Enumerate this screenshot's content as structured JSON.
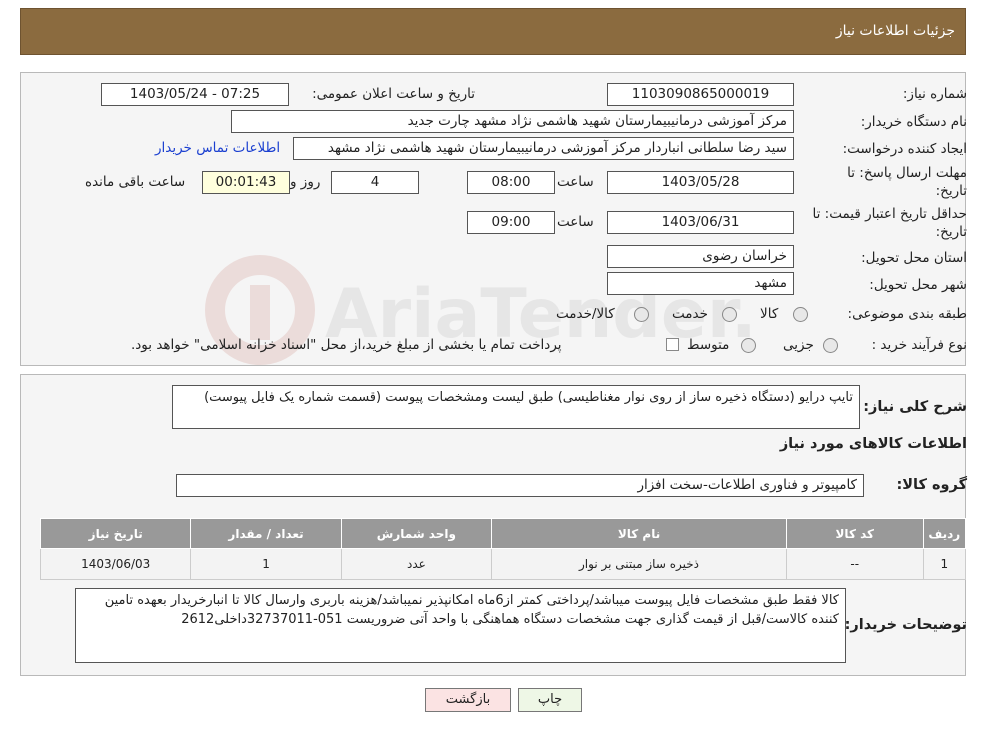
{
  "header": {
    "title": "جزئیات اطلاعات نیاز"
  },
  "form": {
    "need_number_label": "شماره نیاز:",
    "need_number": "1103090865000019",
    "announce_label": "تاریخ و ساعت اعلان عمومی:",
    "announce_value": "1403/05/24 - 07:25",
    "buyer_org_label": "نام دستگاه خریدار:",
    "buyer_org": "مرکز آموزشی درمانیبیمارستان شهید هاشمی نژاد مشهد چارت جدید",
    "creator_label": "ایجاد کننده درخواست:",
    "creator": "سید رضا سلطانی انباردار مرکز آموزشی درمانیبیمارستان شهید هاشمی نژاد مشهد",
    "contact_link": "اطلاعات تماس خریدار",
    "deadline_label_1": "مهلت ارسال پاسخ: تا",
    "deadline_label_2": "تاریخ:",
    "deadline_date": "1403/05/28",
    "time_label": "ساعت",
    "deadline_time": "08:00",
    "days": "4",
    "days_label": "روز و",
    "remaining_time": "00:01:43",
    "remaining_label": "ساعت باقی مانده",
    "validity_label_1": "حداقل تاریخ اعتبار قیمت: تا",
    "validity_label_2": "تاریخ:",
    "validity_date": "1403/06/31",
    "validity_time": "09:00",
    "province_label": "استان محل تحویل:",
    "province": "خراسان رضوی",
    "city_label": "شهر محل تحویل:",
    "city": "مشهد",
    "category_label": "طبقه بندی موضوعی:",
    "category_options": [
      "کالا",
      "خدمت",
      "کالا/خدمت"
    ],
    "process_label": "نوع فرآیند خرید :",
    "process_options": [
      "جزیی",
      "متوسط"
    ],
    "payment_note": "پرداخت تمام یا بخشی از مبلغ خرید،از محل \"اسناد خزانه اسلامی\" خواهد بود."
  },
  "summary": {
    "label": "شرح کلی نیاز:",
    "value": "تایپ درایو (دستگاه ذخیره ساز از روی نوار مغناطیسی) طبق لیست ومشخصات پیوست (قسمت شماره یک فایل پیوست)"
  },
  "goods_title": "اطلاعات کالاهای مورد نیاز",
  "group": {
    "label": "گروه کالا:",
    "value": "کامپیوتر و فناوری اطلاعات-سخت افزار"
  },
  "table": {
    "headers": [
      "ردیف",
      "کد کالا",
      "نام کالا",
      "واحد شمارش",
      "تعداد / مقدار",
      "تاریخ نیاز"
    ],
    "rows": [
      [
        "1",
        "--",
        "ذخیره ساز مبتنی بر نوار",
        "عدد",
        "1",
        "1403/06/03"
      ]
    ]
  },
  "buyer_notes": {
    "label": "توضیحات خریدار:",
    "value": "کالا فقط طبق مشخصات فایل پیوست میباشد/پرداختی کمتر از6ماه امکانپذیر نمیباشد/هزینه باربری وارسال کالا تا انبارخریدار بعهده تامین کننده کالاست/قبل از قیمت گذاری جهت مشخصات دستگاه هماهنگی با واحد آتی ضروریست 051-32737011داخلی2612"
  },
  "buttons": {
    "print": "چاپ",
    "back": "بازگشت"
  },
  "watermark": "AriaTender.neT"
}
